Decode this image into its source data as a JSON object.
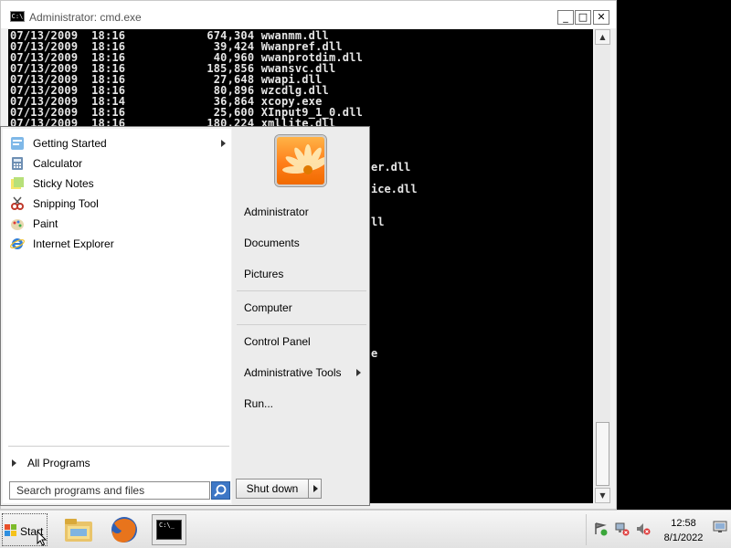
{
  "cmd": {
    "title": "Administrator: cmd.exe",
    "app_icon": "C:\\",
    "minimize": "_",
    "maximize": "□",
    "close": "✕",
    "lines": [
      "07/13/2009  18:16            674,304 wwanmm.dll",
      "07/13/2009  18:16             39,424 Wwanpref.dll",
      "07/13/2009  18:16             40,960 wwanprotdim.dll",
      "07/13/2009  18:16            185,856 wwansvc.dll",
      "07/13/2009  18:16             27,648 wwapi.dll",
      "07/13/2009  18:16             80,896 wzcdlg.dll",
      "07/13/2009  18:14             36,864 xcopy.exe",
      "07/13/2009  18:16             25,600 XInput9_1_0.dll",
      "07/13/2009  18:16            180,224 xmllite.dll"
    ],
    "partial_fragments": [
      "er.dll",
      "ice.dll",
      "ll",
      "e"
    ],
    "scroll_up": "▲",
    "scroll_down": "▼"
  },
  "start_menu": {
    "programs": [
      {
        "label": "Getting Started",
        "icon": "getting-started-icon",
        "has_submenu": true
      },
      {
        "label": "Calculator",
        "icon": "calculator-icon",
        "has_submenu": false
      },
      {
        "label": "Sticky Notes",
        "icon": "sticky-notes-icon",
        "has_submenu": false
      },
      {
        "label": "Snipping Tool",
        "icon": "snipping-tool-icon",
        "has_submenu": false
      },
      {
        "label": "Paint",
        "icon": "paint-icon",
        "has_submenu": false
      },
      {
        "label": "Internet Explorer",
        "icon": "internet-explorer-icon",
        "has_submenu": false
      }
    ],
    "all_programs": "All Programs",
    "search_placeholder": "Search programs and files",
    "right_items": [
      {
        "label": "Administrator"
      },
      {
        "label": "Documents"
      },
      {
        "label": "Pictures"
      },
      {
        "label": "Computer"
      },
      {
        "label": "Control Panel"
      },
      {
        "label": "Administrative Tools",
        "has_submenu": true
      },
      {
        "label": "Run..."
      }
    ],
    "shutdown_label": "Shut down"
  },
  "taskbar": {
    "start_label": "Start",
    "pinned": [
      "explorer-icon",
      "firefox-icon",
      "cmd-icon"
    ],
    "cmd_icon_text": "C:\\_",
    "clock_time": "12:58",
    "clock_date": "8/1/2022"
  },
  "colors": {
    "console_bg": "#000000",
    "console_text": "#e6e6e6",
    "accent": "#3d77c6"
  }
}
